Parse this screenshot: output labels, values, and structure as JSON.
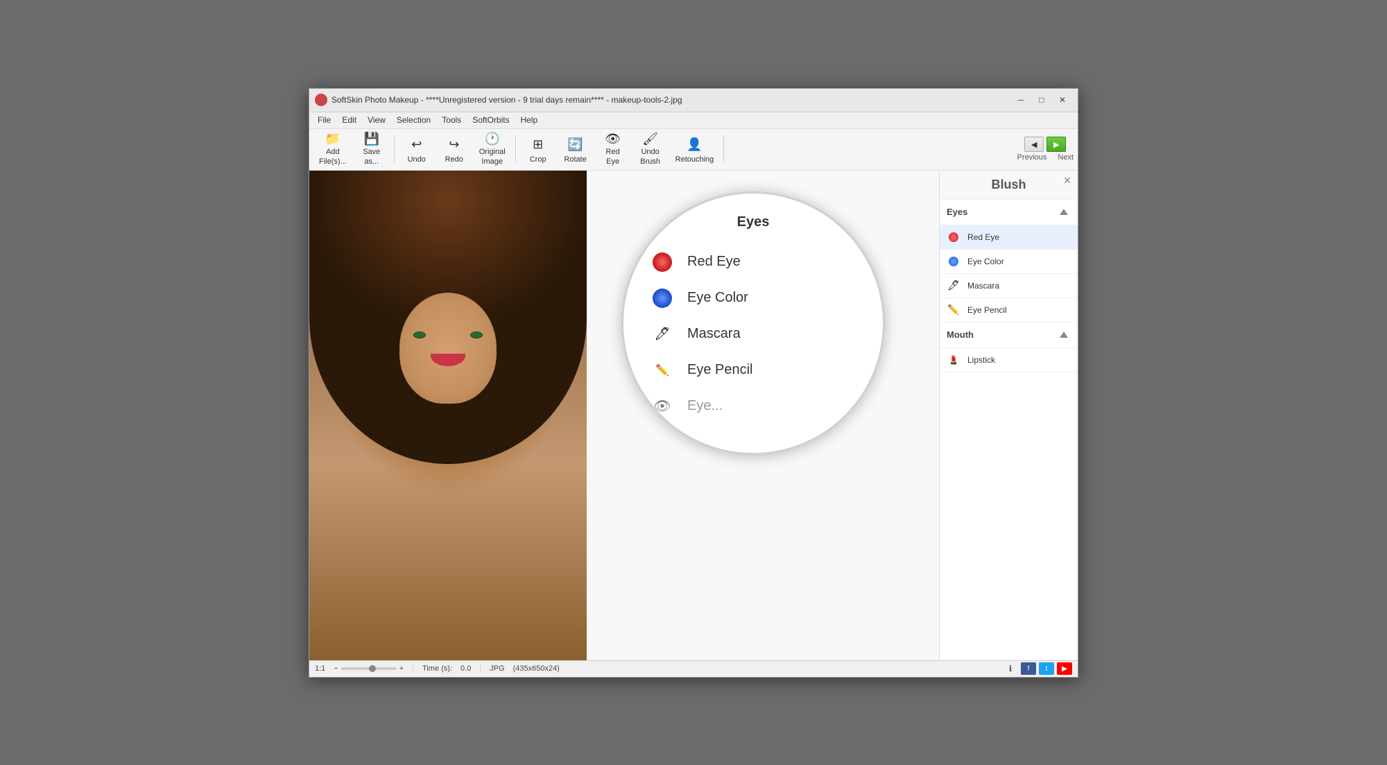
{
  "window": {
    "title": "SoftSkin Photo Makeup - ****Unregistered version - 9 trial days remain**** - makeup-tools-2.jpg",
    "icon_color": "#cc4444"
  },
  "menu": {
    "items": [
      "File",
      "Edit",
      "View",
      "Selection",
      "Tools",
      "SoftOrbits",
      "Help"
    ]
  },
  "toolbar": {
    "buttons": [
      {
        "id": "add-files",
        "label": "Add\nFile(s)...",
        "icon": "📁"
      },
      {
        "id": "save-as",
        "label": "Save\nas...",
        "icon": "💾"
      },
      {
        "id": "undo",
        "label": "Undo",
        "icon": "↩"
      },
      {
        "id": "redo",
        "label": "Redo",
        "icon": "↪"
      },
      {
        "id": "original-image",
        "label": "Original\nImage",
        "icon": "🕐"
      },
      {
        "id": "crop",
        "label": "Crop",
        "icon": "✂"
      },
      {
        "id": "rotate",
        "label": "Rotate",
        "icon": "🔄"
      },
      {
        "id": "red-eye",
        "label": "Red\nEye",
        "icon": "👁"
      },
      {
        "id": "undo-brush",
        "label": "Undo\nBrush",
        "icon": "🖌"
      },
      {
        "id": "retouching",
        "label": "Retouching",
        "icon": "👤"
      }
    ],
    "nav": {
      "previous_label": "Previous",
      "next_label": "Next"
    }
  },
  "panel": {
    "blush_title": "Blush",
    "sections": [
      {
        "id": "eyes",
        "title": "Eyes",
        "items": [
          {
            "id": "red-eye",
            "label": "Red Eye",
            "icon_type": "red-circle"
          },
          {
            "id": "eye-color",
            "label": "Eye Color",
            "icon_type": "blue-circle"
          },
          {
            "id": "mascara",
            "label": "Mascara",
            "icon_type": "mascara"
          },
          {
            "id": "eye-pencil",
            "label": "Eye Pencil",
            "icon_type": "pencil"
          }
        ]
      },
      {
        "id": "mouth",
        "title": "Mouth",
        "items": [
          {
            "id": "lipstick",
            "label": "Lipstick",
            "icon_type": "lipstick"
          }
        ]
      }
    ],
    "small_list": {
      "items": [
        {
          "id": "eye-color-sm",
          "label": "Eye Color",
          "icon_type": "blue-circle"
        },
        {
          "id": "mascara-sm",
          "label": "Mascara",
          "icon_type": "mascara"
        },
        {
          "id": "eye-pencil-sm",
          "label": "Eye Pencil",
          "icon_type": "pencil"
        }
      ]
    }
  },
  "status": {
    "zoom": "1:1",
    "time_label": "Time (s):",
    "time_value": "0.0",
    "format": "JPG",
    "dimensions": "(435x650x24)"
  },
  "zoom_menu": {
    "title": "Eyes",
    "items": [
      {
        "id": "red-eye",
        "label": "Red Eye",
        "icon_type": "red-circle"
      },
      {
        "id": "eye-color",
        "label": "Eye Color",
        "icon_type": "blue-circle"
      },
      {
        "id": "mascara",
        "label": "Mascara",
        "icon_type": "mascara"
      },
      {
        "id": "eye-pencil",
        "label": "Eye Pencil",
        "icon_type": "pencil"
      },
      {
        "id": "eye-partial",
        "label": "Eye...",
        "icon_type": "partial"
      }
    ]
  }
}
